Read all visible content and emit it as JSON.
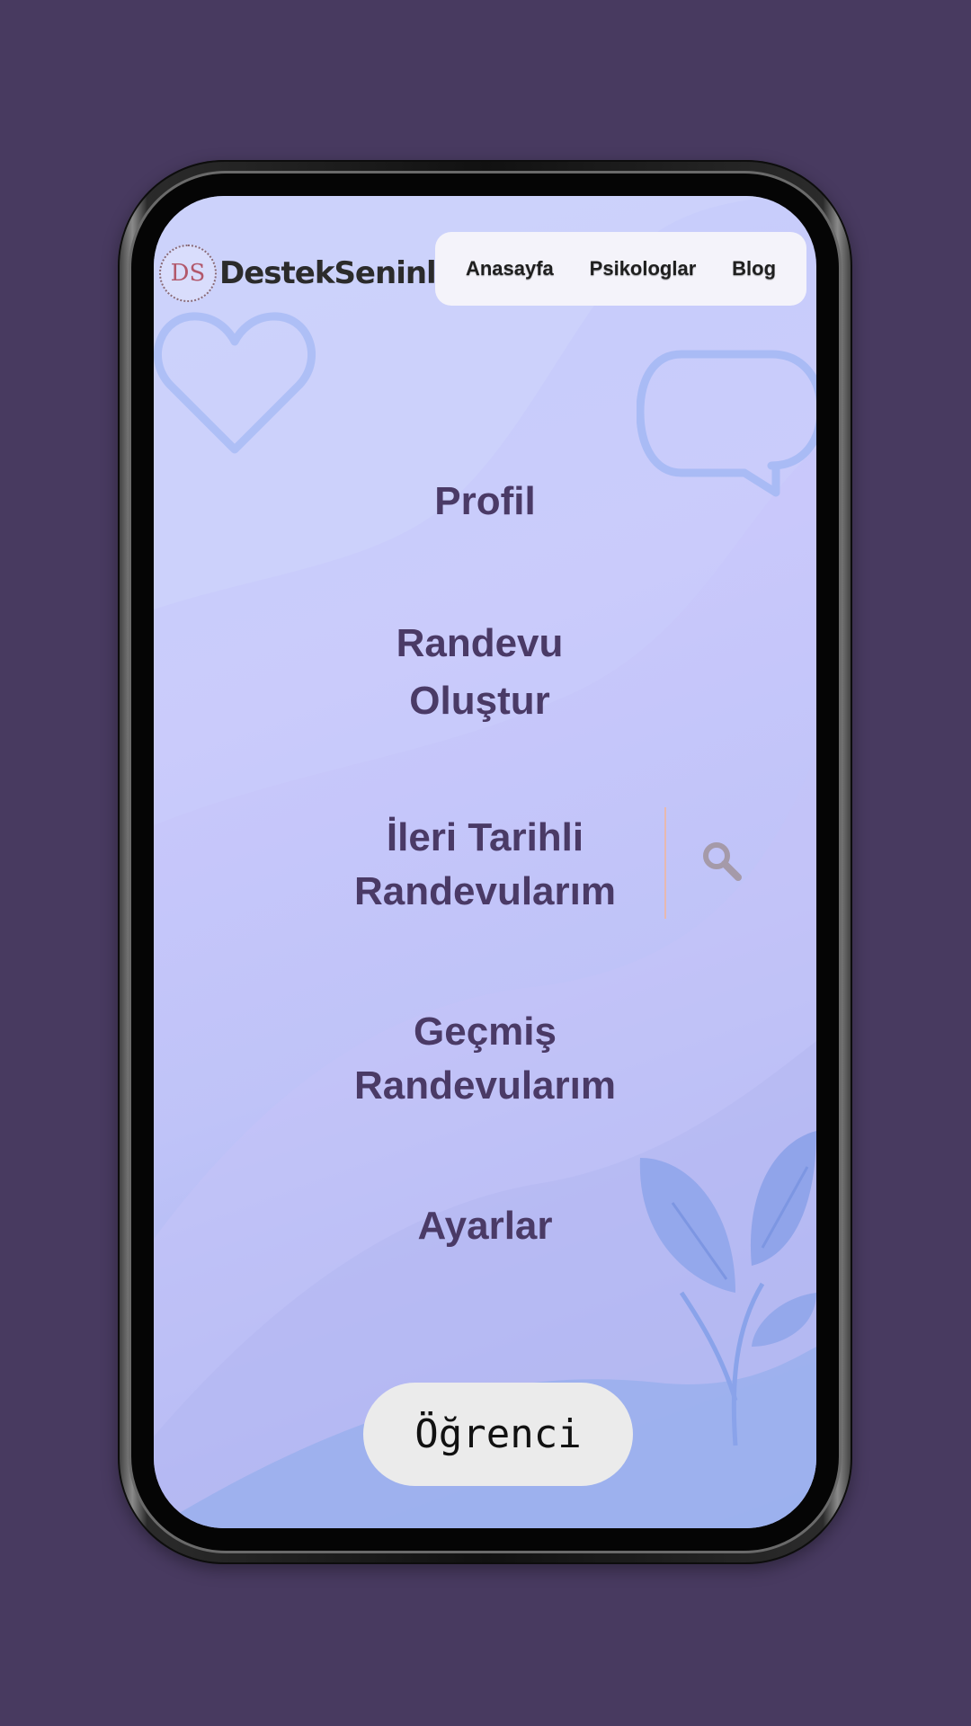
{
  "app": {
    "brand": "DestekSeninle",
    "logo_monogram": "DS"
  },
  "nav": {
    "items": [
      "Anasayfa",
      "Psikologlar",
      "Blog"
    ]
  },
  "menu": {
    "profile": "Profil",
    "create_appointment": [
      "Randevu",
      "Oluştur"
    ],
    "future_appointments": [
      "İleri Tarihli",
      "Randevularım"
    ],
    "past_appointments": [
      "Geçmiş",
      "Randevularım"
    ],
    "settings": "Ayarlar"
  },
  "role_button": {
    "label": "Öğrenci"
  },
  "icons": {
    "search": "search-icon",
    "heart": "heart-icon",
    "chat": "chat-bubble-icon",
    "leaves": "leaf-plant-icon"
  },
  "colors": {
    "background": "#483a60",
    "menu_text": "#4a3a66",
    "nav_bg": "#f4f3fa",
    "button_bg": "#ebebeb"
  }
}
